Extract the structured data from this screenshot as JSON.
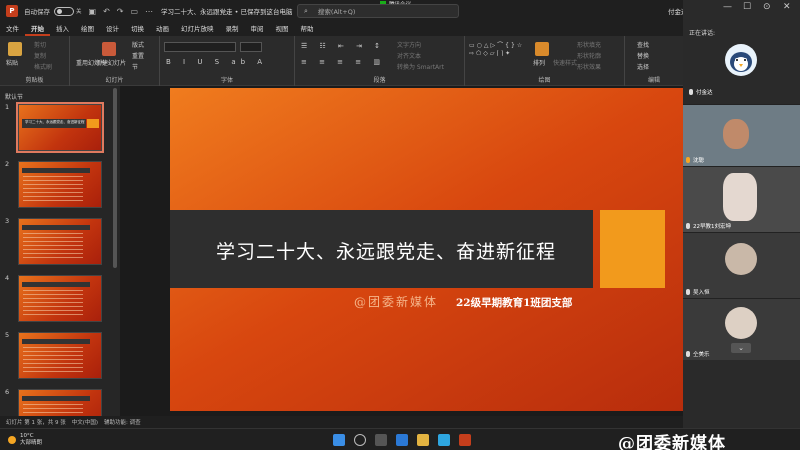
{
  "titlebar": {
    "autosave_label": "自动保存",
    "toggle_state": "关",
    "doc_title": "学习二十大、永远跟党走 • 已保存到这台电脑",
    "search_placeholder": "搜索(Alt+Q)",
    "user": "付金达"
  },
  "meeting": {
    "app_name": "腾讯会议",
    "speaking_label": "正在讲话:",
    "participants": [
      {
        "name": "付金达"
      },
      {
        "name": "沈聪"
      },
      {
        "name": "22早教1刘宏坤"
      },
      {
        "name": "吴入恒"
      },
      {
        "name": "仝美乐"
      }
    ]
  },
  "menu": {
    "items": [
      "文件",
      "开始",
      "插入",
      "绘图",
      "设计",
      "切换",
      "动画",
      "幻灯片放映",
      "录制",
      "审阅",
      "视图",
      "帮助"
    ],
    "active": "开始"
  },
  "ribbon": {
    "groups": [
      {
        "label": "剪贴板"
      },
      {
        "label": "幻灯片"
      },
      {
        "label": "字体"
      },
      {
        "label": "段落"
      },
      {
        "label": "绘图"
      },
      {
        "label": "编辑"
      }
    ],
    "paste": "粘贴",
    "cut": "剪切",
    "copy": "复制",
    "format_painter": "格式刷",
    "new_slide": "新建幻灯片",
    "reuse_slide": "重用幻灯片",
    "layout": "版式",
    "reset": "重置",
    "section": "节",
    "text_direction": "文字方向",
    "align_text": "对齐文本",
    "smartart": "转换为 SmartArt",
    "arrange": "排列",
    "quick_styles": "快速样式",
    "shape_fill": "形状填充",
    "shape_outline": "形状轮廓",
    "shape_effects": "形状效果",
    "find": "查找",
    "replace": "替换",
    "select": "选择"
  },
  "thumbnails": {
    "header": "默认节",
    "numbers": [
      "1",
      "2",
      "3",
      "4",
      "5",
      "6"
    ],
    "slide1_text": "学习二十大、永远跟党走、奋进新征程"
  },
  "slide": {
    "title": "学习二十大、永远跟党走、奋进新征程",
    "watermark": "@团委新媒体",
    "subtitle": "22级早期教育1班团支部"
  },
  "statusbar": {
    "slide_count": "幻灯片 第 1 张，共 9 张",
    "language": "中文(中国)",
    "accessibility": "辅助功能: 调查"
  },
  "taskbar": {
    "weather_temp": "10°C",
    "weather_desc": "大部晴朗",
    "watermark": "@团委新媒体"
  },
  "colors": {
    "accent": "#c43e1c",
    "slide_orange": "#f29a1c",
    "band": "#2e2e2e"
  }
}
